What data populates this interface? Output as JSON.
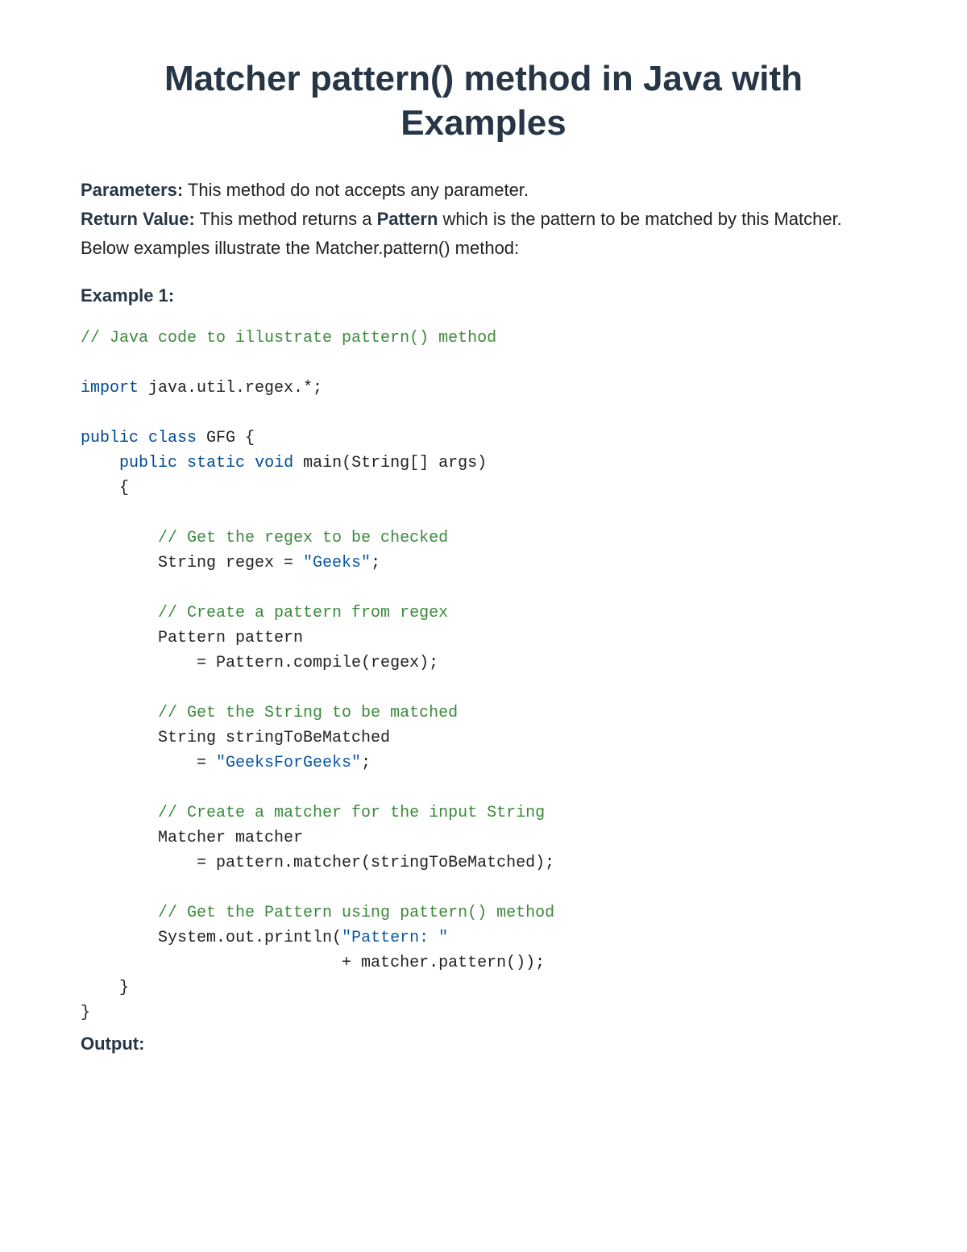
{
  "title": "Matcher pattern() method in Java with Examples",
  "params_label": "Parameters:",
  "params_text": " This method do not accepts any parameter.",
  "return_label": "Return Value:",
  "return_text_before": " This method returns a ",
  "return_pattern": "Pattern",
  "return_text_after": " which is the pattern to be matched by this Matcher.",
  "below_text": "Below examples illustrate the Matcher.pattern() method:",
  "example_label": "Example 1:",
  "code": {
    "c1": "// Java code to illustrate pattern() method",
    "k_import": "import",
    "import_rest": " java.util.regex.*;",
    "k_public1": "public",
    "k_class": "class",
    "class_rest": " GFG {",
    "indent1": "    ",
    "k_public2": "public",
    "k_static": "static",
    "k_void": "void",
    "main_rest": " main(String[] args)",
    "open_brace": "    {",
    "c2": "        // Get the regex to be checked",
    "l_regex_pre": "        String regex = ",
    "s_geeks": "\"Geeks\"",
    "semicolon": ";",
    "c3": "        // Create a pattern from regex",
    "l_pattern1": "        Pattern pattern",
    "l_pattern2": "            = Pattern.compile(regex);",
    "c4": "        // Get the String to be matched",
    "l_str1": "        String stringToBeMatched",
    "l_str2_pre": "            = ",
    "s_gfg": "\"GeeksForGeeks\"",
    "c5": "        // Create a matcher for the input String",
    "l_matcher1": "        Matcher matcher",
    "l_matcher2": "            = pattern.matcher(stringToBeMatched);",
    "c6": "        // Get the Pattern using pattern() method",
    "l_out_pre": "        System.out.println(",
    "s_pattern": "\"Pattern: \"",
    "l_out_post": "                           + matcher.pattern());",
    "close_brace1": "    }",
    "close_brace2": "}"
  },
  "output_label": "Output:"
}
